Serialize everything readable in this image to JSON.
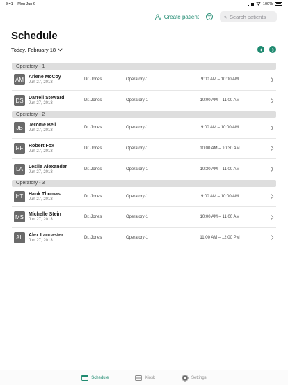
{
  "status_bar": {
    "time": "9:41",
    "date": "Mon Jun 6",
    "battery": "100%"
  },
  "header": {
    "create_patient": "Create patient",
    "search_placeholder": "Search patients"
  },
  "page": {
    "title": "Schedule",
    "date_label": "Today, February 18"
  },
  "colors": {
    "accent": "#1f8a70",
    "avatar": "#6a6a6a",
    "group_header": "#dedede"
  },
  "groups": [
    {
      "title": "Operatory - 1",
      "rows": [
        {
          "initials": "AM",
          "name": "Arlene McCoy",
          "date": "Jun 27, 2013",
          "doctor": "Dr. Jones",
          "operatory": "Operatory-1",
          "time": "9:00 AM – 10:00 AM"
        },
        {
          "initials": "DS",
          "name": "Darrell Steward",
          "date": "Jun 27, 2013",
          "doctor": "Dr. Jones",
          "operatory": "Operatory-1",
          "time": "10:00 AM – 11:00 AM"
        }
      ]
    },
    {
      "title": "Operatory - 2",
      "rows": [
        {
          "initials": "JB",
          "name": "Jerome Bell",
          "date": "Jun 27, 2013",
          "doctor": "Dr. Jones",
          "operatory": "Operatory-1",
          "time": "9:00 AM – 10:00 AM"
        },
        {
          "initials": "RF",
          "name": "Robert Fox",
          "date": "Jun 27, 2013",
          "doctor": "Dr. Jones",
          "operatory": "Operatory-1",
          "time": "10:00 AM – 10:30 AM"
        },
        {
          "initials": "LA",
          "name": "Leslie Alexander",
          "date": "Jun 27, 2013",
          "doctor": "Dr. Jones",
          "operatory": "Operatory-1",
          "time": "10:30 AM – 11:00 AM"
        }
      ]
    },
    {
      "title": "Operatory - 3",
      "rows": [
        {
          "initials": "HT",
          "name": "Hank Thomas",
          "date": "Jun 27, 2013",
          "doctor": "Dr. Jones",
          "operatory": "Operatory-1",
          "time": "9:00 AM – 10:00 AM"
        },
        {
          "initials": "MS",
          "name": "Michelle Stein",
          "date": "Jun 27, 2013",
          "doctor": "Dr. Jones",
          "operatory": "Operatory-1",
          "time": "10:00 AM – 11:00 AM"
        },
        {
          "initials": "AL",
          "name": "Alex Lancaster",
          "date": "Jun 27, 2013",
          "doctor": "Dr. Jones",
          "operatory": "Operatory-1",
          "time": "11:00 AM – 12:00 PM"
        }
      ]
    }
  ],
  "tab_bar": {
    "tabs": [
      {
        "label": "Schedule",
        "icon": "calendar-icon",
        "active": true
      },
      {
        "label": "Kiosk",
        "icon": "kiosk-icon",
        "active": false
      },
      {
        "label": "Settings",
        "icon": "gear-icon",
        "active": false
      }
    ]
  }
}
